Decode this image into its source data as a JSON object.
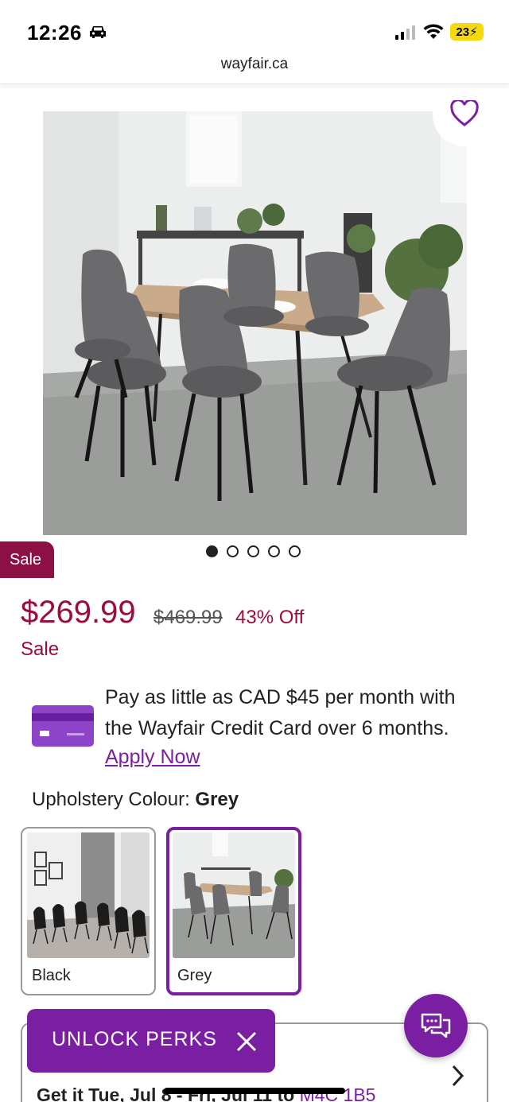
{
  "status_bar": {
    "time": "12:26",
    "battery": "23"
  },
  "url": "wayfair.ca",
  "product": {
    "sale_badge": "Sale",
    "price": "$269.99",
    "old_price": "$469.99",
    "discount": "43% Off",
    "sale_label": "Sale",
    "image_count": 5,
    "active_image": 1
  },
  "promo": {
    "text": "Pay as little as CAD $45 per month with the Wayfair Credit Card over 6 months.",
    "link": "Apply Now"
  },
  "option": {
    "label": "Upholstery Colour: ",
    "selected": "Grey",
    "swatches": [
      {
        "label": "Black"
      },
      {
        "label": "Grey"
      }
    ]
  },
  "delivery": {
    "text": "Get it Tue, Jul 8 - Fri, Jul 11 to ",
    "postal": "M4C 1B5"
  },
  "perks": {
    "label": "UNLOCK PERKS"
  },
  "colors": {
    "accent": "#7b1fa2",
    "sale": "#9b0b3f",
    "badge": "#8c1044"
  }
}
